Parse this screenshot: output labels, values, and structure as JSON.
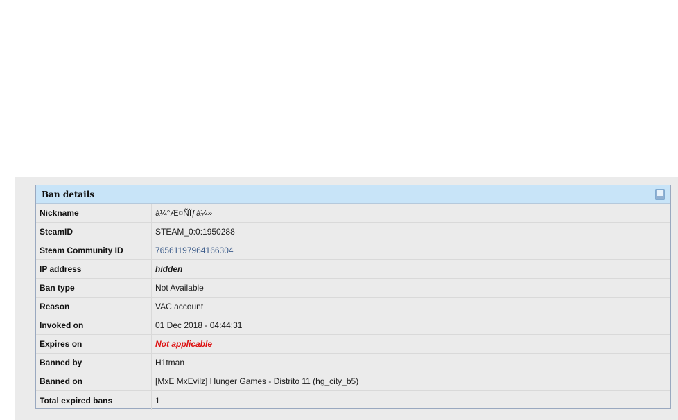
{
  "panel": {
    "title": "Ban details",
    "accent_color": "#c8e4f8",
    "icon": "document-icon"
  },
  "details": {
    "nickname_label": "Nickname",
    "nickname_value": "à¼°Æ¤ÑÏƒà¼»",
    "steamid_label": "SteamID",
    "steamid_value": "STEAM_0:0:1950288",
    "community_label": "Steam Community ID",
    "community_value": "76561197964166304",
    "ip_label": "IP address",
    "ip_value": "hidden",
    "bantype_label": "Ban type",
    "bantype_value": "Not Available",
    "reason_label": "Reason",
    "reason_value": "VAC account",
    "invoked_label": "Invoked on",
    "invoked_value": "01 Dec 2018 - 04:44:31",
    "expires_label": "Expires on",
    "expires_value": "Not applicable",
    "bannedby_label": "Banned by",
    "bannedby_value": "H1tman",
    "bannedon_label": "Banned on",
    "bannedon_value": "[MxE MxEvilz] Hunger Games - Distrito 11 (hg_city_b5)",
    "expired_label": "Total expired bans",
    "expired_value": "1"
  },
  "colors": {
    "link": "#3b5b8a",
    "not_applicable": "#dd1111"
  }
}
